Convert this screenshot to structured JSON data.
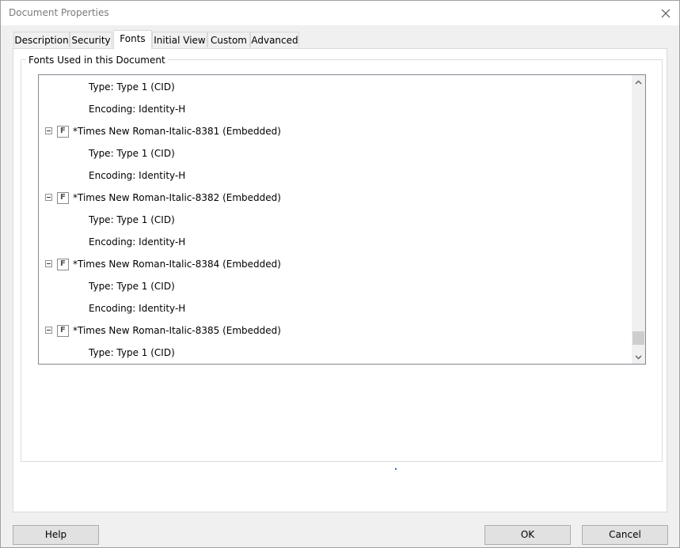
{
  "window": {
    "title": "Document Properties"
  },
  "tabs": [
    {
      "label": "Description"
    },
    {
      "label": "Security"
    },
    {
      "label": "Fonts",
      "active": true
    },
    {
      "label": "Initial View"
    },
    {
      "label": "Custom"
    },
    {
      "label": "Advanced"
    }
  ],
  "group": {
    "label": "Fonts Used in this Document"
  },
  "tree": {
    "rows": [
      {
        "kind": "property",
        "text": "Type: Type 1 (CID)"
      },
      {
        "kind": "property",
        "text": "Encoding: Identity-H"
      },
      {
        "kind": "font",
        "text": "*Times New Roman-Italic-8381 (Embedded)"
      },
      {
        "kind": "property",
        "text": "Type: Type 1 (CID)"
      },
      {
        "kind": "property",
        "text": "Encoding: Identity-H"
      },
      {
        "kind": "font",
        "text": "*Times New Roman-Italic-8382 (Embedded)"
      },
      {
        "kind": "property",
        "text": "Type: Type 1 (CID)"
      },
      {
        "kind": "property",
        "text": "Encoding: Identity-H"
      },
      {
        "kind": "font",
        "text": "*Times New Roman-Italic-8384 (Embedded)"
      },
      {
        "kind": "property",
        "text": "Type: Type 1 (CID)"
      },
      {
        "kind": "property",
        "text": "Encoding: Identity-H"
      },
      {
        "kind": "font",
        "text": "*Times New Roman-Italic-8385 (Embedded)"
      },
      {
        "kind": "property",
        "text": "Type: Type 1 (CID)"
      }
    ],
    "font_icon_glyph": "F",
    "scroll_position": 0.96
  },
  "buttons": {
    "help": "Help",
    "ok": "OK",
    "cancel": "Cancel"
  },
  "icons": {
    "close": "close-icon",
    "scroll_up": "chevron-up-icon",
    "scroll_down": "chevron-down-icon",
    "font": "font-file-icon",
    "collapse": "collapse-minus-icon"
  }
}
